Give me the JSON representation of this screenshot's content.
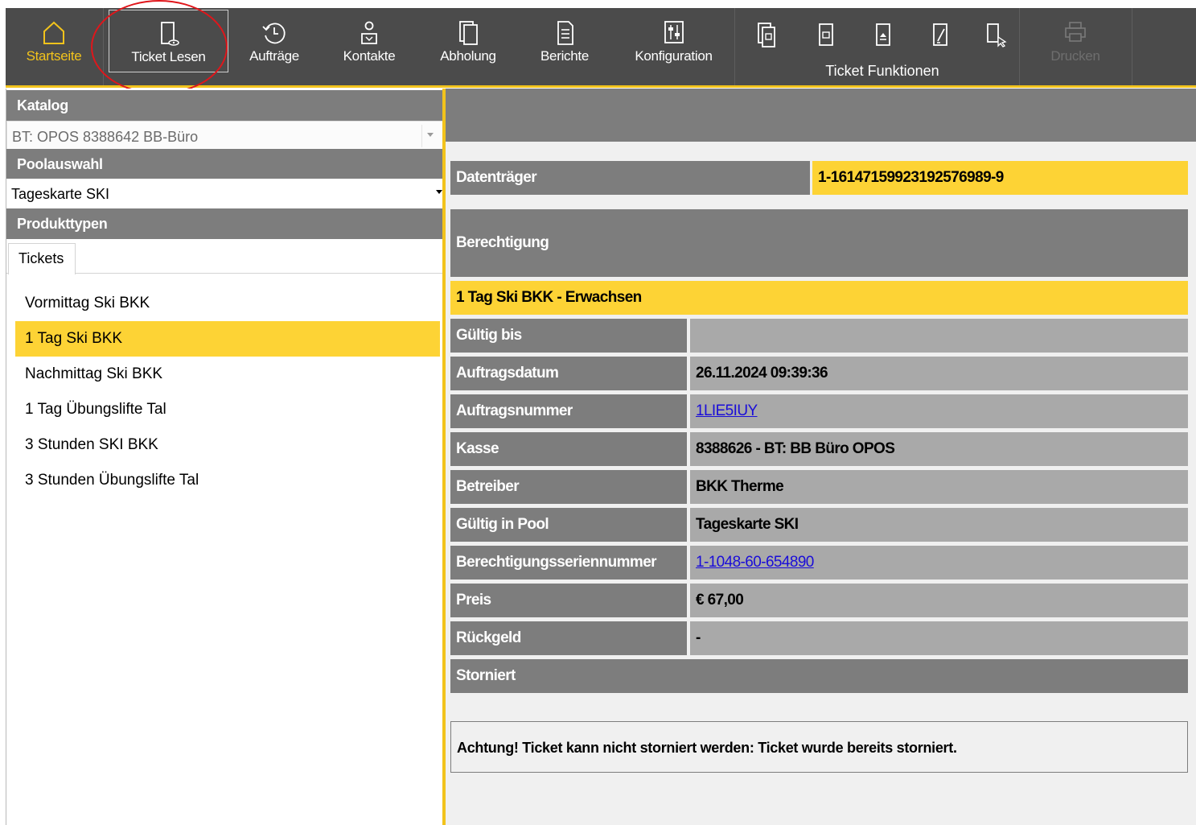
{
  "toolbar": {
    "items": [
      {
        "label": "Startseite",
        "icon": "home-icon"
      },
      {
        "label": "Ticket Lesen",
        "icon": "ticket-read-icon"
      },
      {
        "label": "Aufträge",
        "icon": "history-icon"
      },
      {
        "label": "Kontakte",
        "icon": "contacts-icon"
      },
      {
        "label": "Abholung",
        "icon": "pickup-icon"
      },
      {
        "label": "Berichte",
        "icon": "report-icon"
      },
      {
        "label": "Konfiguration",
        "icon": "configuration-icon"
      }
    ],
    "ticket_functions_label": "Ticket Funktionen",
    "print_label": "Drucken",
    "accent_color": "#f2c31c",
    "highlight_color": "#e0161b"
  },
  "left": {
    "katalog_header": "Katalog",
    "katalog_value": "BT: OPOS 8388642 BB-Büro",
    "pool_header": "Poolauswahl",
    "pool_value": "Tageskarte SKI",
    "produkttypen_header": "Produkttypen",
    "tab_tickets": "Tickets",
    "items": [
      "Vormittag Ski BKK",
      "1 Tag Ski BKK",
      "Nachmittag Ski BKK",
      "1 Tag Übungslifte Tal",
      "3 Stunden SKI BKK",
      "3 Stunden Übungslifte Tal"
    ],
    "selected_item": "1 Tag Ski BKK"
  },
  "detail": {
    "datentraeger_label": "Datenträger",
    "datentraeger_value": "1-16147159923192576989-9",
    "berechtigung_label": "Berechtigung",
    "berechtigung_title": "1 Tag Ski BKK - Erwachsen",
    "gueltig_bis_label": "Gültig bis",
    "gueltig_bis_value": "",
    "auftragsdatum_label": "Auftragsdatum",
    "auftragsdatum_value": "26.11.2024 09:39:36",
    "auftragsnummer_label": "Auftragsnummer",
    "auftragsnummer_value": "1LIE5IUY",
    "kasse_label": "Kasse",
    "kasse_value": "8388626 - BT: BB Büro OPOS",
    "betreiber_label": "Betreiber",
    "betreiber_value": "BKK Therme",
    "pool_label": "Gültig in Pool",
    "pool_value": "Tageskarte SKI",
    "serial_label": "Berechtigungsseriennummer",
    "serial_value": "1-1048-60-654890",
    "preis_label": "Preis",
    "preis_value": "€ 67,00",
    "rueckgeld_label": "Rückgeld",
    "rueckgeld_value": "-",
    "storniert_label": "Storniert",
    "warning": "Achtung! Ticket kann nicht storniert werden: Ticket wurde bereits storniert."
  }
}
